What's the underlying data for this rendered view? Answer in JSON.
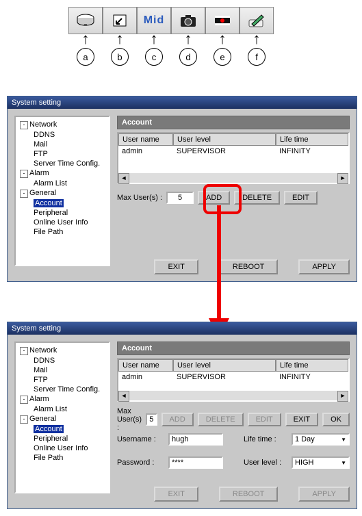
{
  "toolbar": {
    "mid_label": "Mid",
    "callouts": [
      "a",
      "b",
      "c",
      "d",
      "e",
      "f"
    ]
  },
  "icons": {
    "a": "disk-drive-icon",
    "b": "ptz-icon",
    "c": "mid-quality-icon",
    "d": "camera-icon",
    "e": "record-strip-icon",
    "f": "pen-tablet-icon"
  },
  "win_title": "System setting",
  "tree": {
    "network": "Network",
    "ddns": "DDNS",
    "mail": "Mail",
    "ftp": "FTP",
    "stc": "Server Time Config.",
    "alarm": "Alarm",
    "alarm_list": "Alarm List",
    "general": "General",
    "account": "Account",
    "peripheral": "Peripheral",
    "oui": "Online User Info",
    "filepath": "File Path"
  },
  "panel1": {
    "title": "Account",
    "headers": {
      "user": "User name",
      "level": "User level",
      "life": "Life time"
    },
    "row": {
      "user": "admin",
      "level": "SUPERVISOR",
      "life": "INFINITY"
    },
    "max_label": "Max User(s) :",
    "max_value": "5",
    "btn_add": "ADD",
    "btn_delete": "DELETE",
    "btn_edit": "EDIT",
    "btn_exit": "EXIT",
    "btn_reboot": "REBOOT",
    "btn_apply": "APPLY"
  },
  "panel2": {
    "title": "Account",
    "headers": {
      "user": "User name",
      "level": "User level",
      "life": "Life time"
    },
    "row": {
      "user": "admin",
      "level": "SUPERVISOR",
      "life": "INFINITY"
    },
    "max_label": "Max User(s) :",
    "max_value": "5",
    "btn_add": "ADD",
    "btn_delete": "DELETE",
    "btn_edit": "EDIT",
    "btn_exit2": "EXIT",
    "btn_ok": "OK",
    "form": {
      "username_lbl": "Username :",
      "username_val": "hugh",
      "lifetime_lbl": "Life time :",
      "lifetime_val": "1 Day",
      "password_lbl": "Password :",
      "password_val": "****",
      "userlevel_lbl": "User level :",
      "userlevel_val": "HIGH"
    },
    "btn_exit": "EXIT",
    "btn_reboot": "REBOOT",
    "btn_apply": "APPLY"
  }
}
